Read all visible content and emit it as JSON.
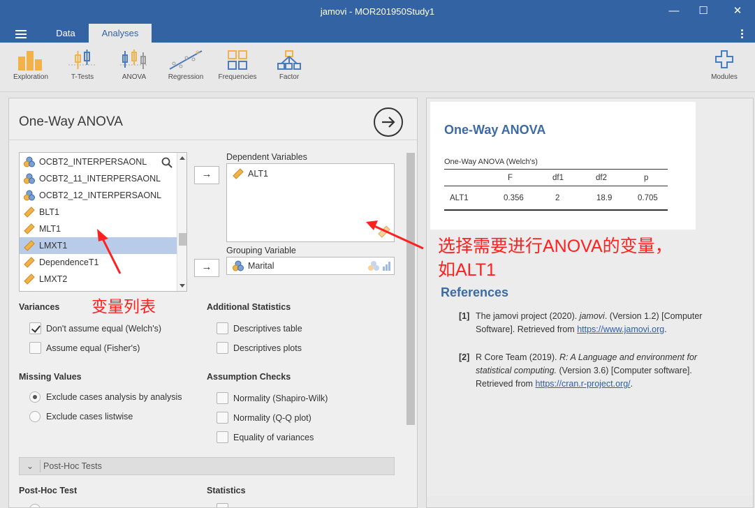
{
  "window": {
    "title": "jamovi - MOR201950Study1",
    "minimize": "—",
    "maximize": "☐",
    "close": "✕"
  },
  "tabs": [
    {
      "label": "Data"
    },
    {
      "label": "Analyses"
    }
  ],
  "ribbon": {
    "buttons": [
      {
        "label": "Exploration",
        "icon": "exploration-icon"
      },
      {
        "label": "T-Tests",
        "icon": "ttests-icon"
      },
      {
        "label": "ANOVA",
        "icon": "anova-icon"
      },
      {
        "label": "Regression",
        "icon": "regression-icon"
      },
      {
        "label": "Frequencies",
        "icon": "frequencies-icon"
      },
      {
        "label": "Factor",
        "icon": "factor-icon"
      }
    ],
    "modules_label": "Modules"
  },
  "options": {
    "title": "One-Way ANOVA",
    "variables": [
      {
        "name": "OCBT2_INTERPERSAONL",
        "type": "nominal"
      },
      {
        "name": "OCBT2_11_INTERPERSAONL",
        "type": "nominal"
      },
      {
        "name": "OCBT2_12_INTERPERSAONL",
        "type": "nominal"
      },
      {
        "name": "BLT1",
        "type": "continuous"
      },
      {
        "name": "MLT1",
        "type": "continuous"
      },
      {
        "name": "LMXT1",
        "type": "continuous",
        "selected": true
      },
      {
        "name": "DependenceT1",
        "type": "continuous"
      },
      {
        "name": "LMXT2",
        "type": "continuous"
      }
    ],
    "move_arrow": "→",
    "dependent_label": "Dependent Variables",
    "dependent_items": [
      "ALT1"
    ],
    "grouping_label": "Grouping Variable",
    "grouping_value": "Marital",
    "variances": {
      "heading": "Variances",
      "welch": "Don't assume equal (Welch's)",
      "fisher": "Assume equal (Fisher's)"
    },
    "additional": {
      "heading": "Additional Statistics",
      "desc_table": "Descriptives table",
      "desc_plots": "Descriptives plots"
    },
    "missing": {
      "heading": "Missing Values",
      "by_analysis": "Exclude cases analysis by analysis",
      "listwise": "Exclude cases listwise"
    },
    "assumption": {
      "heading": "Assumption Checks",
      "shapiro": "Normality (Shapiro-Wilk)",
      "qq": "Normality (Q-Q plot)",
      "equality": "Equality of variances"
    },
    "posthoc_bar": "Post-Hoc Tests",
    "posthoc_test_heading": "Post-Hoc Test",
    "statistics_heading": "Statistics"
  },
  "annotations": {
    "varlist": "变量列表",
    "choose_line1": "选择需要进行ANOVA的变量，",
    "choose_line2": "如ALT1",
    "color": "#ff2020"
  },
  "results": {
    "title": "One-Way ANOVA",
    "table_title": "One-Way ANOVA (Welch's)",
    "columns": [
      "",
      "F",
      "df1",
      "df2",
      "p"
    ],
    "row": {
      "var": "ALT1",
      "F": "0.356",
      "df1": "2",
      "df2": "18.9",
      "p": "0.705"
    },
    "references_title": "References",
    "refs": [
      {
        "num": "[1]",
        "pre": "The jamovi project (2020). ",
        "ital": "jamovi",
        "post": ". (Version 1.2) [Computer Software]. Retrieved from ",
        "url": "https://www.jamovi.org",
        "end": "."
      },
      {
        "num": "[2]",
        "pre": "R Core Team (2019). ",
        "ital": "R: A Language and environment for statistical computing.",
        "post": " (Version 3.6) [Computer software]. Retrieved from ",
        "url": "https://cran.r-project.org/",
        "end": "."
      }
    ]
  },
  "colors": {
    "brand": "#3463a3",
    "results_title": "#3c6aa5",
    "selected_row": "#b8cbe8"
  }
}
